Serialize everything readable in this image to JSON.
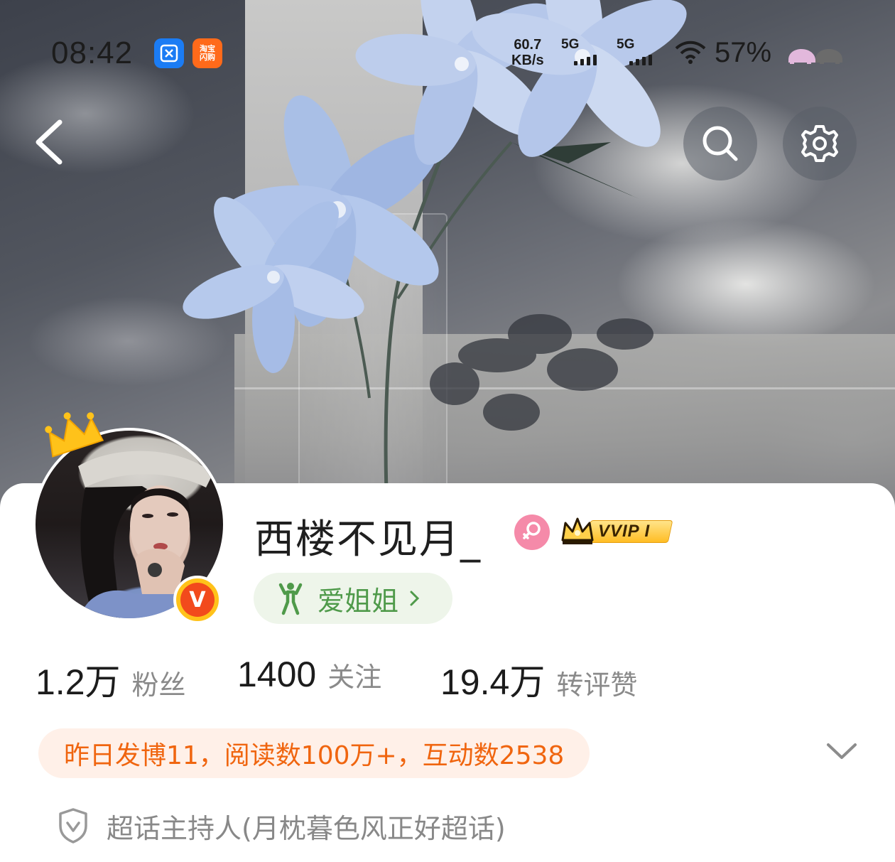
{
  "status_bar": {
    "time": "08:42",
    "app_badges": [
      "scissors-app-icon",
      "taobao-flash-app-icon"
    ],
    "taobao_badge_text": "淘宝\n闪购",
    "net_speed_value": "60.7",
    "net_speed_unit": "KB/s",
    "signal_1_label": "5G",
    "signal_2_label": "5G",
    "battery_percent": "57%"
  },
  "nav": {
    "back_icon": "chevron-left-icon",
    "search_icon": "search-icon",
    "settings_icon": "gear-icon"
  },
  "profile": {
    "username": "西楼不见月_",
    "gender": "female",
    "vip_badge": "VVIP I",
    "verified_badge": "V",
    "tag": {
      "label": "爱姐姐",
      "icon": "fitness-person-icon"
    },
    "stats": [
      {
        "value": "1.2万",
        "label": "粉丝"
      },
      {
        "value": "1400",
        "label": "关注"
      },
      {
        "value": "19.4万",
        "label": "转评赞"
      }
    ],
    "activity_summary": "昨日发博11，阅读数100万+，互动数2538",
    "host_info": "超话主持人(月枕暮色风正好超话)"
  },
  "colors": {
    "accent_orange": "#f0650f",
    "tag_green": "#4f9a4a",
    "gender_pink": "#f58aa9",
    "vip_gold": "#ffbd24",
    "verified_red": "#f24a1c"
  }
}
